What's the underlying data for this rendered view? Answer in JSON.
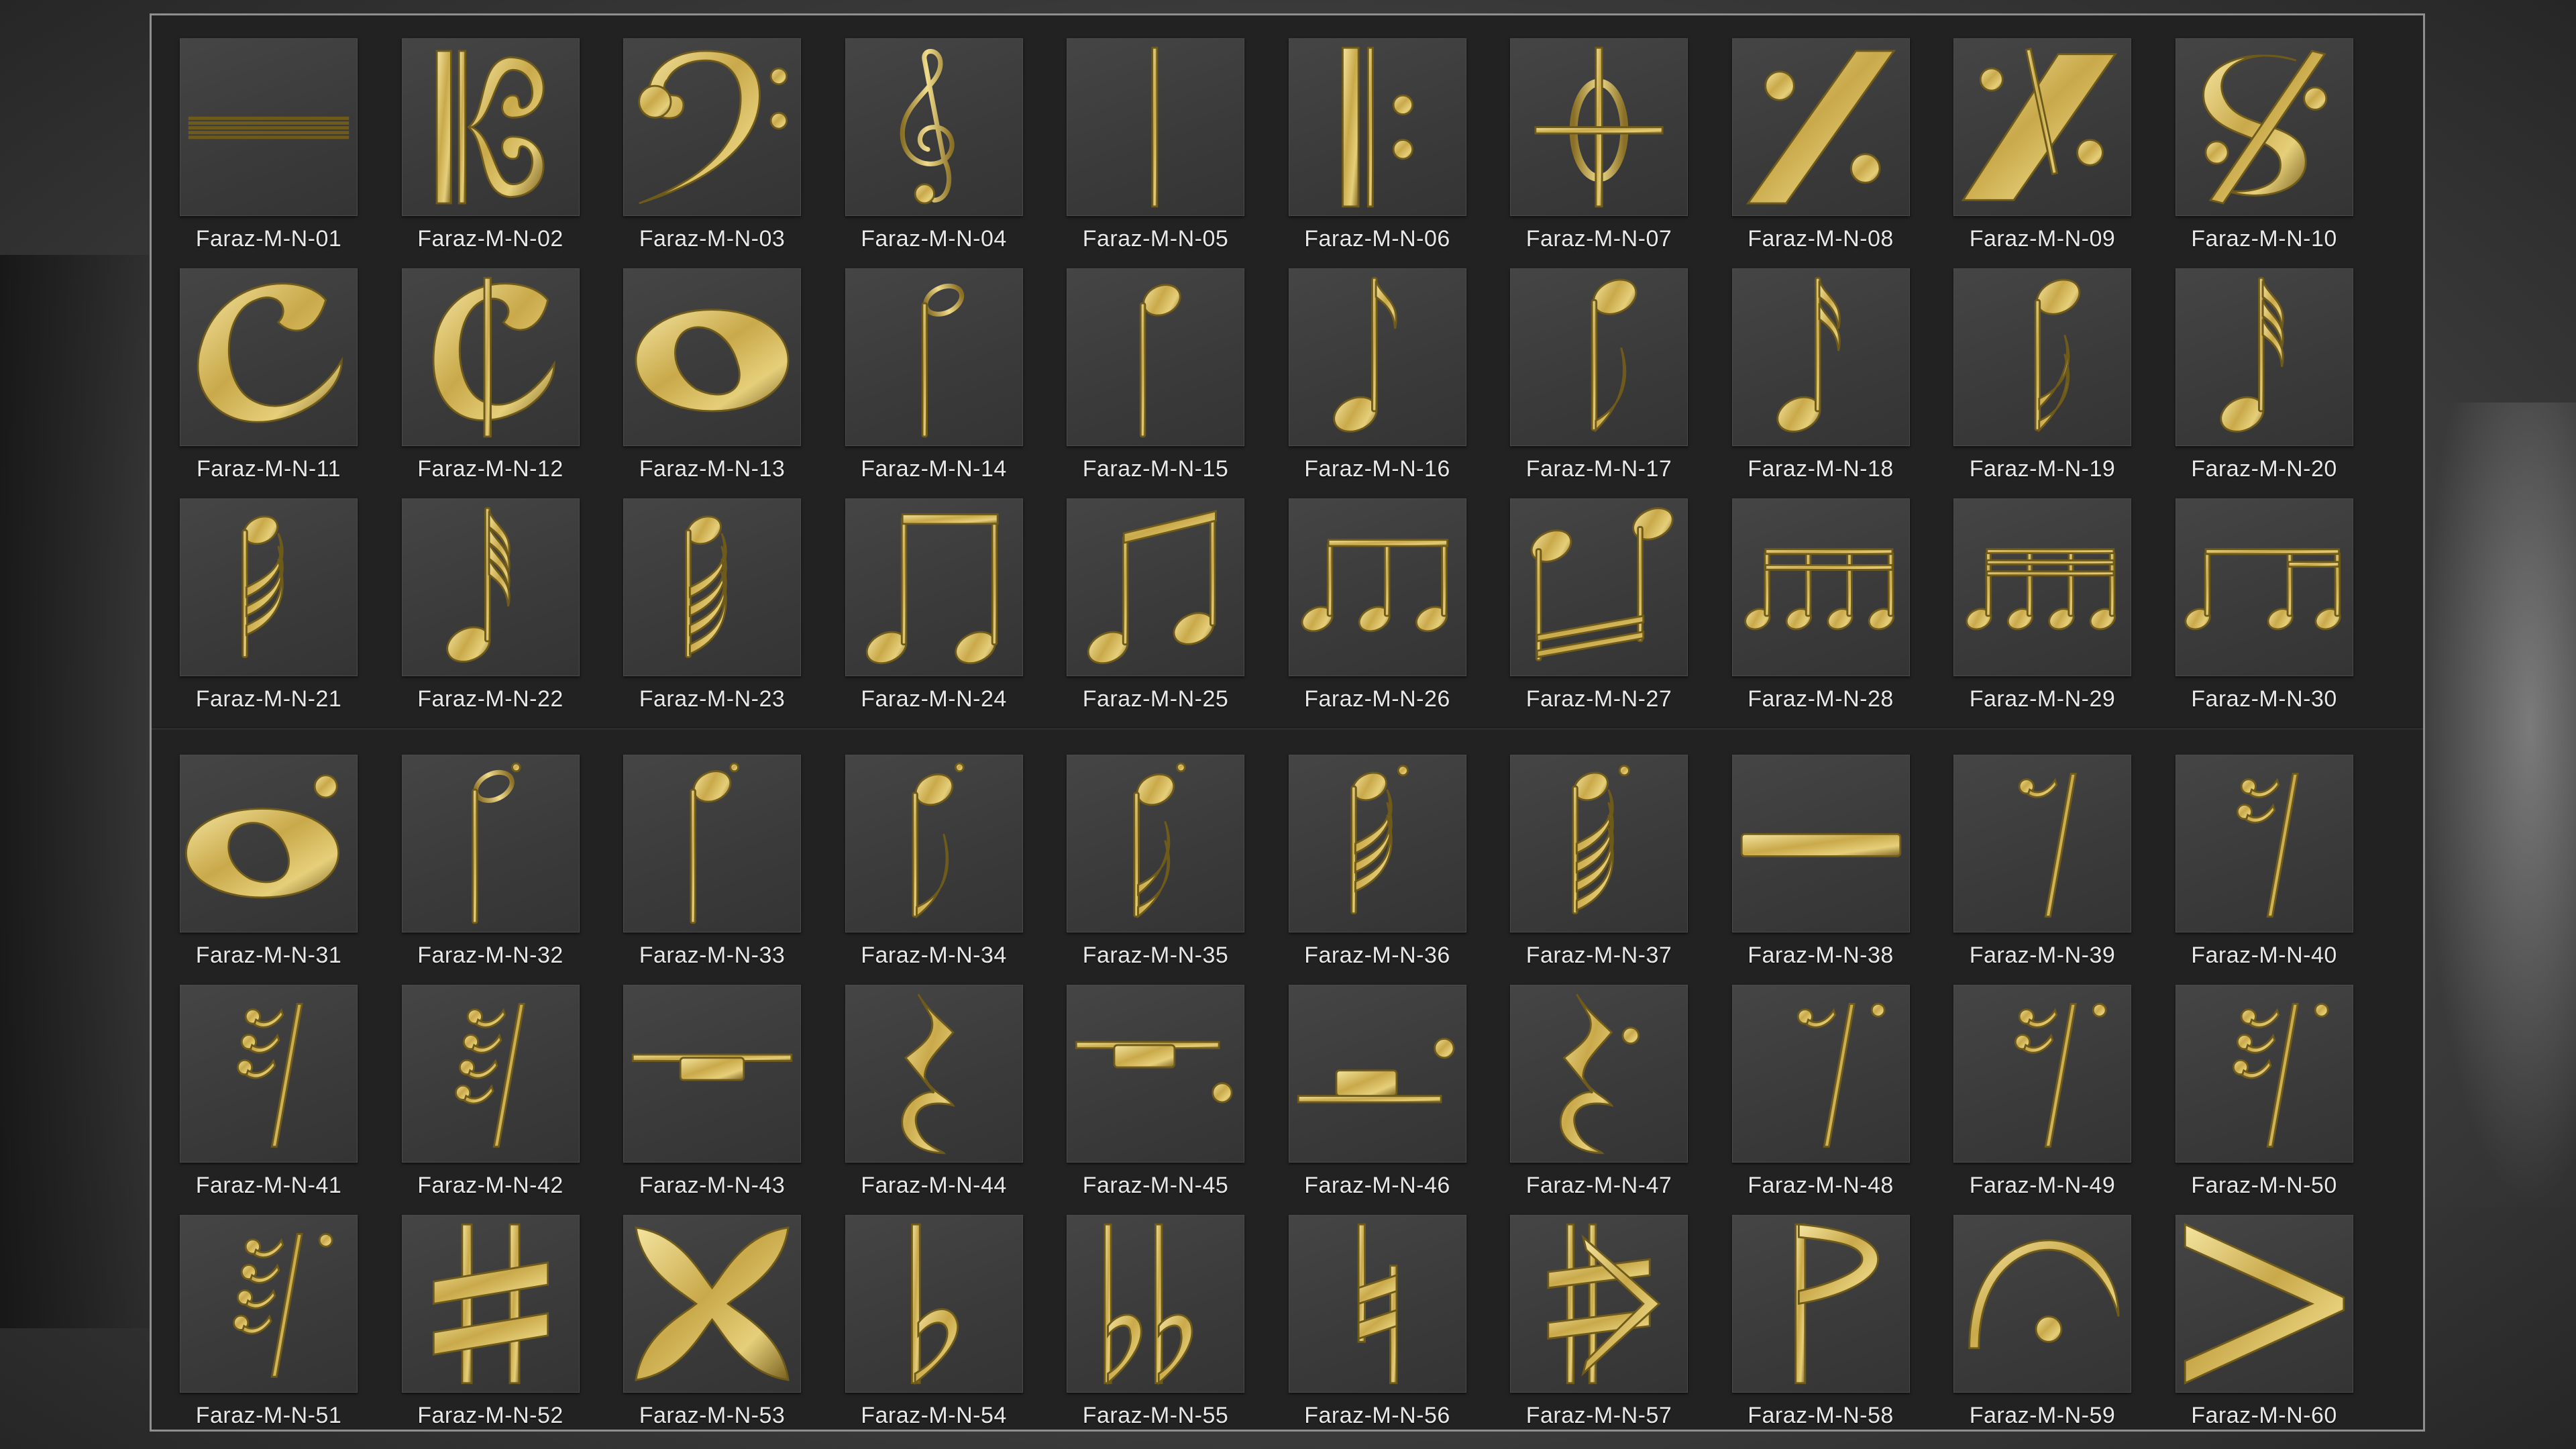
{
  "colors": {
    "panel_background": "#222222",
    "tile_background": "#3d3d3d",
    "label_text": "#e8e8e8",
    "gold_light": "#f4e4a0",
    "gold_mid": "#c9a94a",
    "gold_dark": "#7a6220"
  },
  "symbols": [
    {
      "label": "Faraz-M-N-01",
      "icon": "staff-lines-icon"
    },
    {
      "label": "Faraz-M-N-02",
      "icon": "alto-clef-icon"
    },
    {
      "label": "Faraz-M-N-03",
      "icon": "bass-clef-icon"
    },
    {
      "label": "Faraz-M-N-04",
      "icon": "treble-clef-icon"
    },
    {
      "label": "Faraz-M-N-05",
      "icon": "barline-icon"
    },
    {
      "label": "Faraz-M-N-06",
      "icon": "repeat-start-icon"
    },
    {
      "label": "Faraz-M-N-07",
      "icon": "coda-icon"
    },
    {
      "label": "Faraz-M-N-08",
      "icon": "simile-icon"
    },
    {
      "label": "Faraz-M-N-09",
      "icon": "double-simile-icon"
    },
    {
      "label": "Faraz-M-N-10",
      "icon": "segno-icon"
    },
    {
      "label": "Faraz-M-N-11",
      "icon": "common-time-icon"
    },
    {
      "label": "Faraz-M-N-12",
      "icon": "cut-time-icon"
    },
    {
      "label": "Faraz-M-N-13",
      "icon": "whole-note-icon"
    },
    {
      "label": "Faraz-M-N-14",
      "icon": "half-note-icon"
    },
    {
      "label": "Faraz-M-N-15",
      "icon": "quarter-note-icon"
    },
    {
      "label": "Faraz-M-N-16",
      "icon": "eighth-note-icon"
    },
    {
      "label": "Faraz-M-N-17",
      "icon": "eighth-note-stem-down-icon"
    },
    {
      "label": "Faraz-M-N-18",
      "icon": "sixteenth-note-icon"
    },
    {
      "label": "Faraz-M-N-19",
      "icon": "sixteenth-note-stem-down-icon"
    },
    {
      "label": "Faraz-M-N-20",
      "icon": "thirty-second-note-icon"
    },
    {
      "label": "Faraz-M-N-21",
      "icon": "thirty-second-note-stem-down-icon"
    },
    {
      "label": "Faraz-M-N-22",
      "icon": "sixty-fourth-note-icon"
    },
    {
      "label": "Faraz-M-N-23",
      "icon": "sixty-fourth-note-stem-down-icon"
    },
    {
      "label": "Faraz-M-N-24",
      "icon": "beamed-eighth-pair-icon"
    },
    {
      "label": "Faraz-M-N-25",
      "icon": "beamed-eighth-pair-slanted-icon"
    },
    {
      "label": "Faraz-M-N-26",
      "icon": "beamed-eighth-triplet-icon"
    },
    {
      "label": "Faraz-M-N-27",
      "icon": "beamed-sixteenth-pair-icon"
    },
    {
      "label": "Faraz-M-N-28",
      "icon": "beamed-sixteenth-group-icon"
    },
    {
      "label": "Faraz-M-N-29",
      "icon": "beamed-thirty-second-group-icon"
    },
    {
      "label": "Faraz-M-N-30",
      "icon": "beamed-mixed-group-icon"
    },
    {
      "label": "Faraz-M-N-31",
      "icon": "dotted-whole-note-icon"
    },
    {
      "label": "Faraz-M-N-32",
      "icon": "dotted-half-note-icon"
    },
    {
      "label": "Faraz-M-N-33",
      "icon": "dotted-quarter-note-icon"
    },
    {
      "label": "Faraz-M-N-34",
      "icon": "dotted-eighth-note-icon"
    },
    {
      "label": "Faraz-M-N-35",
      "icon": "dotted-sixteenth-note-icon"
    },
    {
      "label": "Faraz-M-N-36",
      "icon": "dotted-thirty-second-note-icon"
    },
    {
      "label": "Faraz-M-N-37",
      "icon": "dotted-sixty-fourth-note-icon"
    },
    {
      "label": "Faraz-M-N-38",
      "icon": "whole-rest-bar-icon"
    },
    {
      "label": "Faraz-M-N-39",
      "icon": "eighth-rest-icon"
    },
    {
      "label": "Faraz-M-N-40",
      "icon": "sixteenth-rest-icon"
    },
    {
      "label": "Faraz-M-N-41",
      "icon": "thirty-second-rest-icon"
    },
    {
      "label": "Faraz-M-N-42",
      "icon": "sixty-fourth-rest-icon"
    },
    {
      "label": "Faraz-M-N-43",
      "icon": "half-rest-icon"
    },
    {
      "label": "Faraz-M-N-44",
      "icon": "quarter-rest-icon"
    },
    {
      "label": "Faraz-M-N-45",
      "icon": "dotted-whole-rest-icon"
    },
    {
      "label": "Faraz-M-N-46",
      "icon": "dotted-half-rest-icon"
    },
    {
      "label": "Faraz-M-N-47",
      "icon": "dotted-quarter-rest-icon"
    },
    {
      "label": "Faraz-M-N-48",
      "icon": "dotted-eighth-rest-icon"
    },
    {
      "label": "Faraz-M-N-49",
      "icon": "dotted-sixteenth-rest-icon"
    },
    {
      "label": "Faraz-M-N-50",
      "icon": "dotted-thirty-second-rest-icon"
    },
    {
      "label": "Faraz-M-N-51",
      "icon": "dotted-sixty-fourth-rest-icon"
    },
    {
      "label": "Faraz-M-N-52",
      "icon": "sharp-icon"
    },
    {
      "label": "Faraz-M-N-53",
      "icon": "double-sharp-icon"
    },
    {
      "label": "Faraz-M-N-54",
      "icon": "flat-icon"
    },
    {
      "label": "Faraz-M-N-55",
      "icon": "double-flat-icon"
    },
    {
      "label": "Faraz-M-N-56",
      "icon": "natural-icon"
    },
    {
      "label": "Faraz-M-N-57",
      "icon": "half-sharp-icon"
    },
    {
      "label": "Faraz-M-N-58",
      "icon": "pennant-icon"
    },
    {
      "label": "Faraz-M-N-59",
      "icon": "fermata-icon"
    },
    {
      "label": "Faraz-M-N-60",
      "icon": "accent-icon"
    }
  ]
}
